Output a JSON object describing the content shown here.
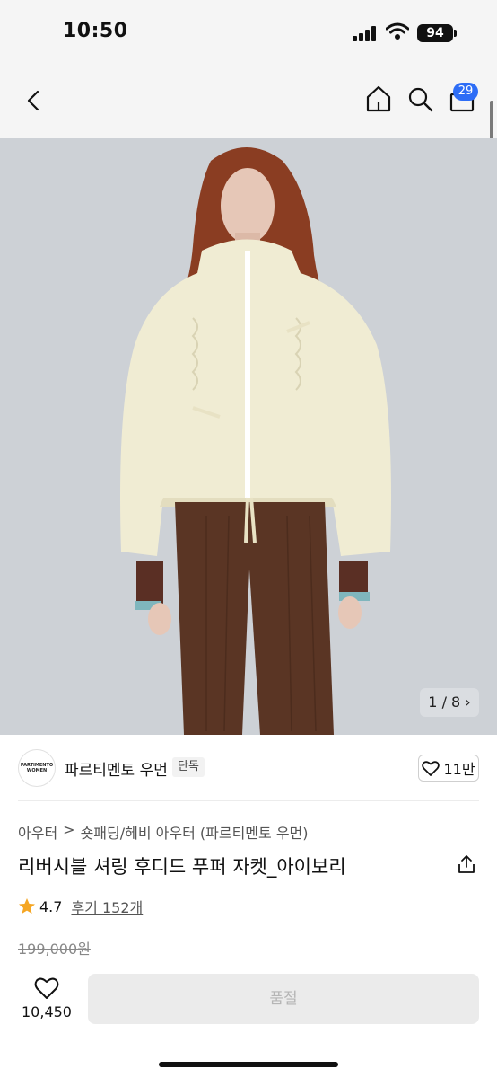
{
  "status_bar": {
    "time": "10:50",
    "battery": "94"
  },
  "nav": {
    "cart_count": "29"
  },
  "gallery": {
    "counter": "1 / 8 ›"
  },
  "brand": {
    "logo_text": "PARTIMENTO WOMEN",
    "name": "파르티멘토 우먼",
    "badge": "단독",
    "likes": "11만"
  },
  "breadcrumb": {
    "items": [
      "아우터",
      "숏패딩/헤비 아우터 (파르티멘토 우먼)"
    ],
    "separator": ">"
  },
  "product": {
    "title": "리버시블 셔링 후디드 푸퍼 자켓_아이보리",
    "rating": "4.7",
    "reviews": "후기 152개",
    "original_price": "199,000원"
  },
  "bottom_bar": {
    "wish_count": "10,450",
    "action_label": "품절"
  },
  "icons": [
    "back-icon",
    "home-icon",
    "search-icon",
    "cart-icon",
    "heart-icon",
    "share-icon",
    "star-icon"
  ],
  "colors": {
    "accent_blue": "#2d6df6",
    "star": "#f5a623",
    "disabled_button": "#ebebeb"
  }
}
